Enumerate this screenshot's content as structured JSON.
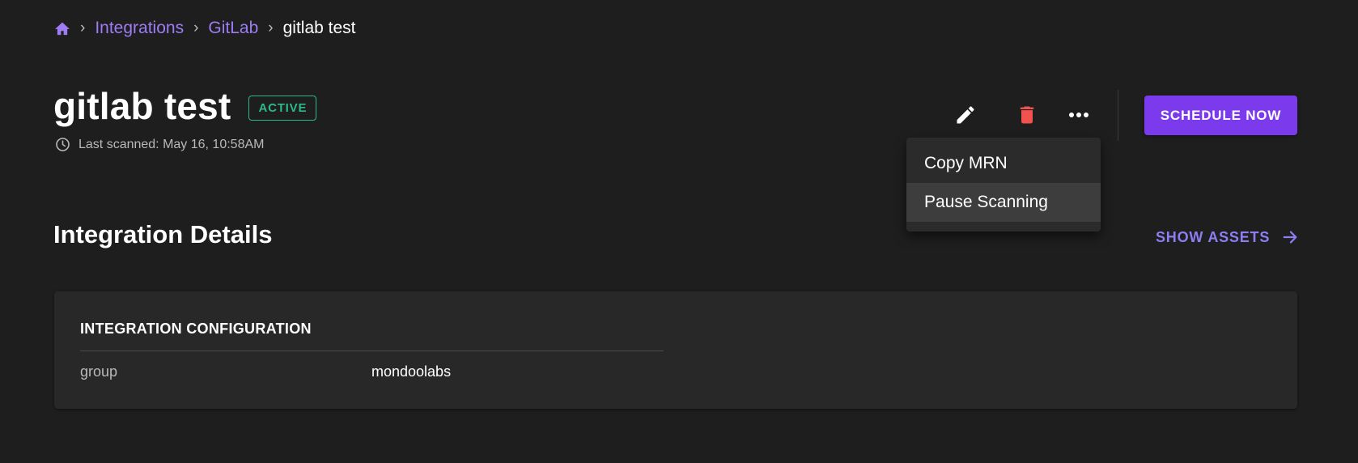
{
  "breadcrumb": {
    "home_icon": "home-icon",
    "items": [
      "Integrations",
      "GitLab"
    ],
    "current": "gitlab test",
    "separator": "›"
  },
  "header": {
    "title": "gitlab test",
    "status": "ACTIVE",
    "last_scanned": "Last scanned: May 16, 10:58AM",
    "actions": {
      "edit_icon": "pencil-icon",
      "delete_icon": "trash-icon",
      "more_icon": "more-horizontal-icon",
      "schedule_label": "SCHEDULE NOW"
    }
  },
  "menu": {
    "items": [
      "Copy MRN",
      "Pause Scanning"
    ],
    "hovered_index": 1
  },
  "section": {
    "title": "Integration Details",
    "show_assets_label": "SHOW ASSETS"
  },
  "configuration": {
    "heading": "INTEGRATION CONFIGURATION",
    "rows": [
      {
        "key": "group",
        "value": "mondoolabs"
      }
    ]
  },
  "colors": {
    "background": "#1e1e1e",
    "accent": "#7c3aed",
    "link": "#9d7cf4",
    "status_active": "#2fb98a",
    "delete": "#f0524f"
  }
}
